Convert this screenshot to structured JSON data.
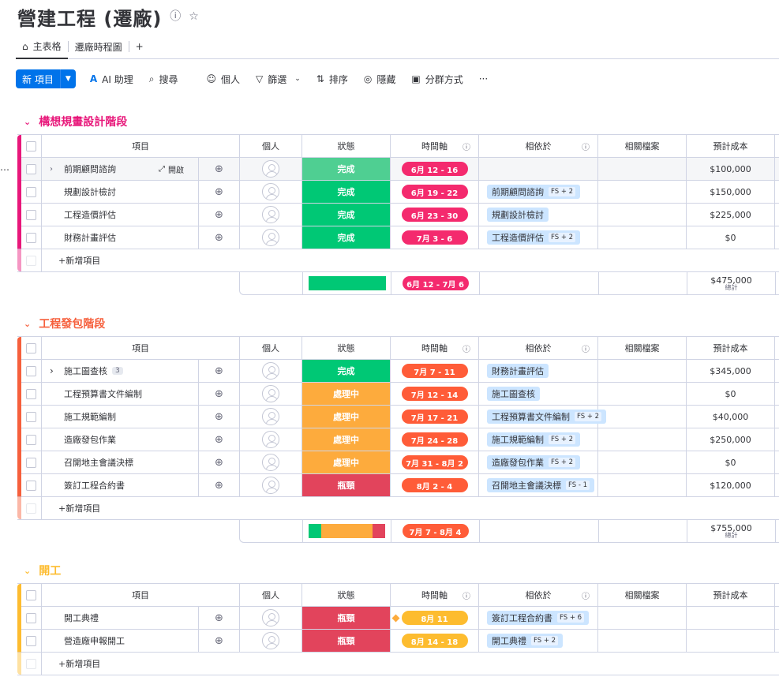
{
  "page": {
    "title": "營建工程 (遷廠)"
  },
  "tabs": [
    {
      "label": "主表格"
    },
    {
      "label": "遷廠時程圖"
    },
    {
      "label": "+"
    }
  ],
  "toolbar": {
    "new_item": "新 項目",
    "ai": "AI 助理",
    "search": "搜尋",
    "person": "個人",
    "filter": "篩選",
    "sort": "排序",
    "hide": "隱藏",
    "group_by": "分群方式",
    "more": "···"
  },
  "columns": {
    "item": "項目",
    "person": "個人",
    "status": "狀態",
    "timeline": "時間軸",
    "depends": "相依於",
    "files": "相關檔案",
    "cost": "預計成本"
  },
  "add_item_label": "+新增項目",
  "open_label": "開啟",
  "total_label": "總計",
  "colors": {
    "done": "#00c875",
    "done_hover": "#4fcf92",
    "working": "#fdab3d",
    "stuck": "#e2445c",
    "group1": "#e8177a",
    "group2": "#f65f3c",
    "group3": "#fdbc2f",
    "pill_g1": "#f42a6e",
    "pill_g2": "#ff5c38",
    "pill_g3": "#fdbc2f"
  },
  "groups": [
    {
      "title": "構想規畫設計階段",
      "rows": [
        {
          "name": "前期顧問諮詢",
          "status": "完成",
          "status_key": "done_hover",
          "timeline": "6月 12 - 16",
          "dep": "",
          "dep_tag": "",
          "cost": "$100,000"
        },
        {
          "name": "規劃設計檢討",
          "status": "完成",
          "status_key": "done",
          "timeline": "6月 19 - 22",
          "dep": "前期顧問諮詢",
          "dep_tag": "FS + 2",
          "cost": "$150,000"
        },
        {
          "name": "工程造價評估",
          "status": "完成",
          "status_key": "done",
          "timeline": "6月 23 - 30",
          "dep": "規劃設計檢討",
          "dep_tag": "",
          "cost": "$225,000"
        },
        {
          "name": "財務計畫評估",
          "status": "完成",
          "status_key": "done",
          "timeline": "7月 3 - 6",
          "dep": "工程造價評估",
          "dep_tag": "FS + 2",
          "cost": "$0"
        }
      ],
      "summary": {
        "timeline": "6月 12 - 7月 6",
        "total": "$475,000",
        "status_mix": [
          {
            "key": "done",
            "fraction": 1
          }
        ]
      }
    },
    {
      "title": "工程發包階段",
      "rows": [
        {
          "name": "施工圖查核",
          "sub_count": "3",
          "status": "完成",
          "status_key": "done",
          "timeline": "7月 7 - 11",
          "dep": "財務計畫評估",
          "dep_tag": "",
          "cost": "$345,000"
        },
        {
          "name": "工程預算書文件編制",
          "status": "處理中",
          "status_key": "working",
          "timeline": "7月 12 - 14",
          "dep": "施工圖查核",
          "dep_tag": "",
          "cost": "$0"
        },
        {
          "name": "施工規範編制",
          "status": "處理中",
          "status_key": "working",
          "timeline": "7月 17 - 21",
          "dep": "工程預算書文件編制",
          "dep_tag": "FS + 2",
          "cost": "$40,000"
        },
        {
          "name": "造廠發包作業",
          "status": "處理中",
          "status_key": "working",
          "timeline": "7月 24 - 28",
          "dep": "施工規範編制",
          "dep_tag": "FS + 2",
          "cost": "$250,000"
        },
        {
          "name": "召開地主會議決標",
          "status": "處理中",
          "status_key": "working",
          "timeline": "7月 31 - 8月 2",
          "dep": "造廠發包作業",
          "dep_tag": "FS + 2",
          "cost": "$0"
        },
        {
          "name": "簽訂工程合約書",
          "status": "瓶頸",
          "status_key": "stuck",
          "timeline": "8月 2 - 4",
          "dep": "召開地主會議決標",
          "dep_tag": "FS - 1",
          "cost": "$120,000"
        }
      ],
      "summary": {
        "timeline": "7月 7 - 8月 4",
        "total": "$755,000",
        "status_mix": [
          {
            "key": "done",
            "fraction": 0.17
          },
          {
            "key": "working",
            "fraction": 0.66
          },
          {
            "key": "stuck",
            "fraction": 0.17
          }
        ]
      }
    },
    {
      "title": "開工",
      "rows": [
        {
          "name": "開工典禮",
          "status": "瓶頸",
          "status_key": "stuck",
          "timeline": "8月 11",
          "dep": "簽訂工程合約書",
          "dep_tag": "FS + 6",
          "cost": ""
        },
        {
          "name": "營造廠申報開工",
          "status": "瓶頸",
          "status_key": "stuck",
          "timeline": "8月 14 - 18",
          "dep": "開工典禮",
          "dep_tag": "FS + 2",
          "cost": ""
        }
      ]
    }
  ]
}
